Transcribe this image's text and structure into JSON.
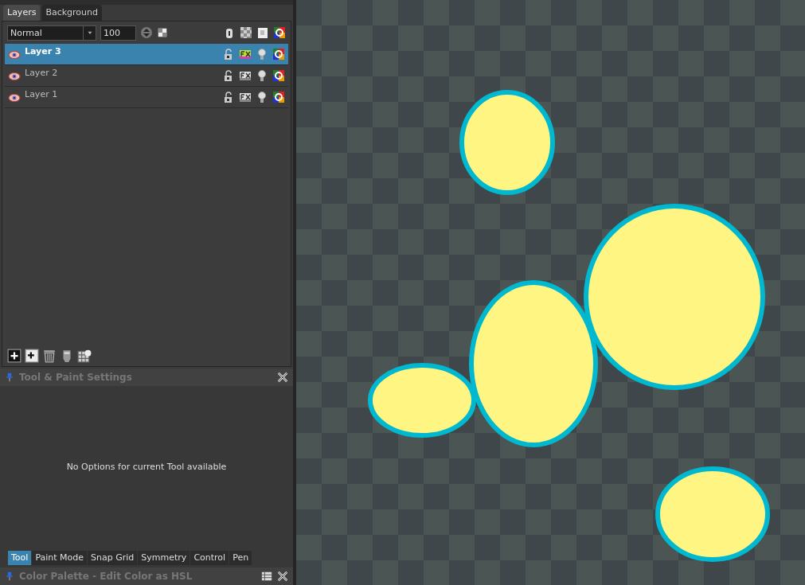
{
  "layer_panel_tabs": [
    {
      "label": "Layers",
      "selected": true
    },
    {
      "label": "Background",
      "selected": false
    }
  ],
  "blend_mode": {
    "value": "Normal"
  },
  "opacity": {
    "value": "100"
  },
  "layers": [
    {
      "name": "Layer 3",
      "selected": true
    },
    {
      "name": "Layer 2",
      "selected": false
    },
    {
      "name": "Layer 1",
      "selected": false
    }
  ],
  "tool_settings": {
    "title": "Tool & Paint Settings",
    "message": "No Options for current Tool available"
  },
  "tool_tabs": [
    {
      "label": "Tool",
      "selected": true
    },
    {
      "label": "Paint Mode",
      "selected": false
    },
    {
      "label": "Snap Grid",
      "selected": false
    },
    {
      "label": "Symmetry",
      "selected": false
    },
    {
      "label": "Control",
      "selected": false
    },
    {
      "label": "Pen",
      "selected": false
    }
  ],
  "color_palette": {
    "title": "Color Palette - Edit Color as HSL"
  }
}
